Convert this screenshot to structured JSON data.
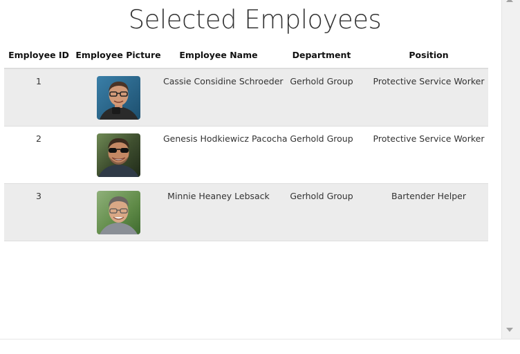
{
  "page": {
    "title": "Selected Employees"
  },
  "table": {
    "headers": [
      "Employee ID",
      "Employee Picture",
      "Employee Name",
      "Department",
      "Position"
    ],
    "rows": [
      {
        "id": "1",
        "picture": "employee-photo-1",
        "name": "Cassie Considine Schroeder",
        "department": "Gerhold Group",
        "position": "Protective Service Worker"
      },
      {
        "id": "2",
        "picture": "employee-photo-2",
        "name": "Genesis Hodkiewicz Pacocha",
        "department": "Gerhold Group",
        "position": "Protective Service Worker"
      },
      {
        "id": "3",
        "picture": "employee-photo-3",
        "name": "Minnie Heaney Lebsack",
        "department": "Gerhold Group",
        "position": "Bartender Helper"
      }
    ]
  },
  "colors": {
    "row_stripe": "#ececec",
    "text": "#333333",
    "header_text": "#111111",
    "border": "#dddddd"
  },
  "icons": {
    "scroll_up": "triangle-up-icon",
    "scroll_down": "triangle-down-icon"
  }
}
